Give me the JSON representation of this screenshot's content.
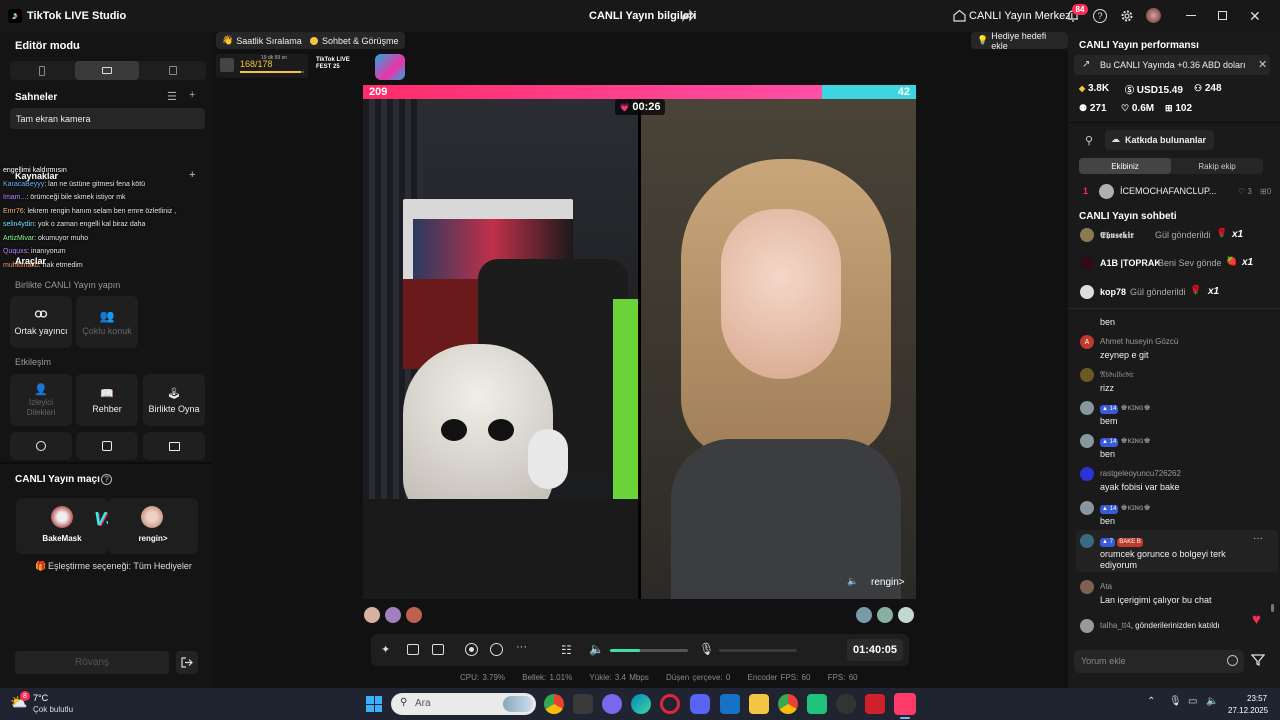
{
  "app": {
    "title": "TikTok LIVE Studio",
    "center_title": "CANLI Yayın bilgileri",
    "live_center": "CANLI Yayın Merkezi",
    "notif_count": "84"
  },
  "left": {
    "editor_mode": "Editör modu",
    "scenes_title": "Sahneler",
    "scene_item": "Tam ekran kamera",
    "sources_title": "Kaynaklar",
    "tools_title": "Araçlar",
    "live_together": "Birlikte CANLI Yayın yapın",
    "co_host": "Ortak yayıncı",
    "multi_guest": "Çoklu konuk",
    "interaction": "Etkileşim",
    "viewer_requests": "İzleyici Dilekleri",
    "guide": "Rehber",
    "play_together": "Birlikte Oyna",
    "match_title": "CANLI Yayın maçı",
    "player1": "BakeMask",
    "player2": "rengin>",
    "vs": "VS",
    "pairing": "Eşleştirme seçeneği: Tüm Hediyeler",
    "rematch": "Rövanş"
  },
  "overlay_chat": [
    {
      "name": "",
      "msg": "engellimi kaldırmısın",
      "color": "#ffffff"
    },
    {
      "name": "KaracaBeyyy",
      "msg": ": lan ne üstüne gitmesi fena kötü",
      "color": "#6ab0ff"
    },
    {
      "name": "Imam...",
      "msg": ": örümceği bile skmek istiyor mk",
      "color": "#c080ff"
    },
    {
      "name": "Emr76",
      "msg": ": lekrem rengin hanım selam ben emre özletliniz ,",
      "color": "#ffb070"
    },
    {
      "name": "selin4ydin",
      "msg": ": yok o zaman engelli kal biraz daha",
      "color": "#70e0ff"
    },
    {
      "name": "ArtizMivar",
      "msg": ": okumuyor muho",
      "color": "#8aff8a"
    },
    {
      "name": "Ququxs",
      "msg": ": inanıyorum",
      "color": "#c080ff"
    },
    {
      "name": "muhittinakb",
      "msg": ": hak etmedim",
      "color": "#ff9a6a"
    }
  ],
  "top_chips": {
    "ranking": "Saatlik Sıralama",
    "chat_meet": "Sohbet & Görüşme",
    "gift_goal": "Hediye hedefi ekle",
    "viewer_count": "168/178",
    "time_left": "19 dk 59 sn",
    "event_label": "TikTok LIVE FEST 25"
  },
  "battle": {
    "left_score": "209",
    "right_score": "42",
    "timer": "00:26",
    "guest_name": "rengin>",
    "left_share": 0.83
  },
  "controls": {
    "duration": "01:40:05",
    "volume": 0.38
  },
  "stats": {
    "cpu": "CPU:  3.79%",
    "memory": "Bellek:  1.01%",
    "upload": "Yükle:  3.4 Mbps",
    "dropped": "Düşen çerçeve:  0",
    "encoder_fps": "Encoder FPS:  60",
    "fps": "FPS:  60"
  },
  "right": {
    "perf_title": "CANLI Yayın performansı",
    "earnings": "Bu CANLI Yayında +0.36 ABD doları",
    "stat1": "3.8K",
    "stat2": "USD15.49",
    "stat3": "248",
    "stat4": "271",
    "stat5": "0.6M",
    "stat6": "102",
    "contributors": "Katkıda bulunanlar",
    "tab_team": "Ekibiniz",
    "tab_rival": "Rakip ekip",
    "rank_num": "1",
    "rank_name": "İCEMOCHAFANCLUP...",
    "rank_a": "3",
    "rank_b": "0",
    "chat_title": "CANLI Yayın sohbeti",
    "gifts": [
      {
        "name": "𝕰𝖇𝖚𝖘𝖊𝖐𝖎𝖗",
        "text": "Gül gönderildi",
        "count": "x1"
      },
      {
        "name": "A1B |TOPRAK",
        "text": "Beni Sev gönde",
        "count": "x1"
      },
      {
        "name": "kop78",
        "text": "Gül gönderildi",
        "count": "x1"
      }
    ],
    "messages": [
      {
        "name": "",
        "msg": "ben",
        "badge": ""
      },
      {
        "name": "Ahmet huseyin Gözcü",
        "msg": "zeynep e git",
        "badge": ""
      },
      {
        "name": "𝔄𝔟𝔡𝔲𝔩𝔟𝔢𝔡𝔦𝔯",
        "msg": "rizz",
        "badge": ""
      },
      {
        "name": "♚ᴋɪɴɢ♚",
        "msg": "bem",
        "badge": "14"
      },
      {
        "name": "♚ᴋɪɴɢ♚",
        "msg": "ben",
        "badge": "14"
      },
      {
        "name": "rastgeleoyuncu726262",
        "msg": "ayak fobisi var bake",
        "badge": ""
      },
      {
        "name": "♚ᴋɪɴɢ♚",
        "msg": "ben",
        "badge": "14"
      },
      {
        "name": "BAKE B",
        "msg": "orumcek gorunce o bolgeyi terk ediyorum",
        "badge": "7"
      },
      {
        "name": "Ata",
        "msg": "Lan içerigimi çalıyor bu chat",
        "badge": ""
      }
    ],
    "join_name": "talha_tt4",
    "join_text": ", gönderilerinizden katıldı",
    "comment_placeholder": "Yorum ekle"
  },
  "taskbar": {
    "temp": "7°C",
    "weather": "Çok bulutlu",
    "search": "Ara",
    "time": "23:57",
    "date": "27.12.2025"
  }
}
